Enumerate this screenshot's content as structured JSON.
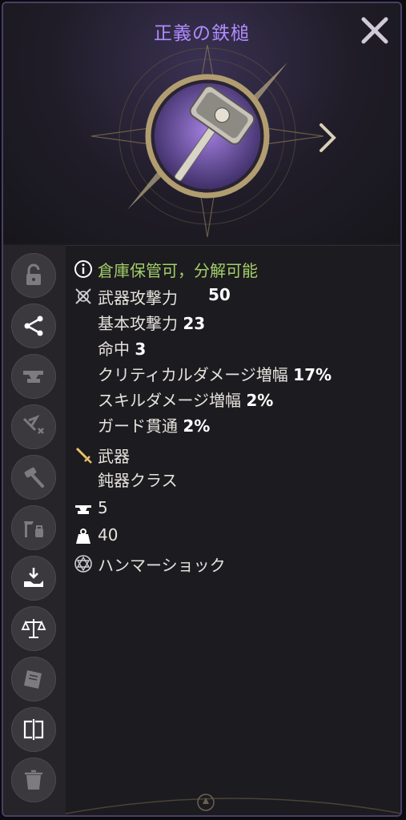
{
  "title": "正義の鉄槌",
  "status_text": "倉庫保管可，分解可能",
  "stats": [
    {
      "label": "武器攻撃力",
      "value": "50"
    },
    {
      "label": "基本攻撃力",
      "value": "23"
    },
    {
      "label": "命中",
      "value": "3"
    },
    {
      "label": "クリティカルダメージ増幅",
      "value": "17%"
    },
    {
      "label": "スキルダメージ増幅",
      "value": "2%"
    },
    {
      "label": "ガード貫通",
      "value": "2%"
    }
  ],
  "type": {
    "category": "武器",
    "class": "鈍器クラス"
  },
  "enhance_level": "5",
  "weight": "40",
  "skill": "ハンマーショック",
  "colors": {
    "title": "#b08cff",
    "status": "#a4cf6a",
    "frame": "#4a3f66"
  },
  "sidebar_icons": [
    "lock-open-icon",
    "share-icon",
    "anvil-icon",
    "craft-icon",
    "hammer-icon",
    "tools-icon",
    "deposit-icon",
    "scales-icon",
    "book-icon",
    "compare-icon",
    "trash-icon"
  ]
}
